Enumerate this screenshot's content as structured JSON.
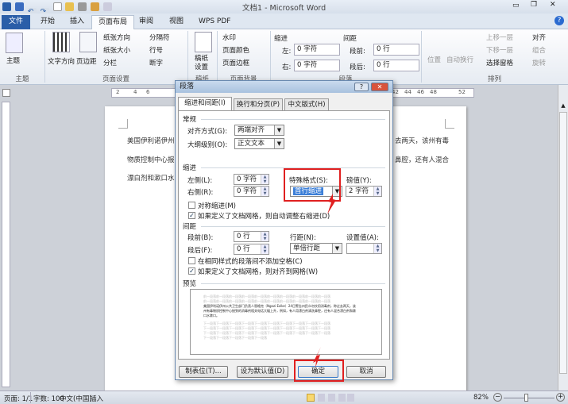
{
  "window": {
    "title": "文档1 - Microsoft Word"
  },
  "ribbon_tabs": [
    {
      "label": "文件"
    },
    {
      "label": "开始"
    },
    {
      "label": "插入"
    },
    {
      "label": "页面布局"
    },
    {
      "label": "审阅"
    },
    {
      "label": "视图"
    },
    {
      "label": "WPS PDF"
    }
  ],
  "ribbon": {
    "theme": {
      "label": "主题",
      "group": "主题"
    },
    "page_setup": {
      "text_direction": "文字方向",
      "margins": "页边距",
      "orientation": "纸张方向",
      "size": "纸张大小",
      "columns": "分栏",
      "breaks": "分隔符",
      "line_numbers": "行号",
      "hyphenation": "断字",
      "group": "页面设置"
    },
    "draft": {
      "label": "稿纸\n设置",
      "group": "稿纸"
    },
    "background": {
      "watermark": "水印",
      "page_color": "页面颜色",
      "page_borders": "页面边框",
      "group": "页面背景"
    },
    "paragraph": {
      "indent_label": "缩进",
      "left_label": "左:",
      "left_value": "0 字符",
      "right_label": "右:",
      "right_value": "0 字符",
      "spacing_label": "间距",
      "before_label": "段前:",
      "before_value": "0 行",
      "after_label": "段后:",
      "after_value": "0 行",
      "group": "段落"
    },
    "arrange": {
      "position": "位置",
      "wrap": "自动换行",
      "forward": "上移一层",
      "backward": "下移一层",
      "selection_pane": "选择窗格",
      "align": "对齐",
      "group_btn": "组合",
      "rotate": "旋转",
      "group": "排列"
    }
  },
  "ruler": {
    "ticks": [
      "2",
      "2",
      "4",
      "6",
      "42",
      "44",
      "46",
      "48",
      "52"
    ]
  },
  "document": {
    "lines": [
      "美国伊利诺伊州",
      "物质控制中心报",
      "漂白剂和漱口水",
      "去两天，该州有毒",
      "鼻腔，还有人混合"
    ]
  },
  "dialog": {
    "title": "段落",
    "help": "?",
    "close": "✕",
    "tabs": [
      {
        "label": "缩进和间距(I)"
      },
      {
        "label": "换行和分页(P)"
      },
      {
        "label": "中文版式(H)"
      }
    ],
    "general": {
      "title": "常规",
      "alignment_label": "对齐方式(G):",
      "alignment_value": "两端对齐",
      "outline_label": "大纲级别(O):",
      "outline_value": "正文文本"
    },
    "indent": {
      "title": "缩进",
      "left_label": "左侧(L):",
      "left_value": "0 字符",
      "right_label": "右侧(R):",
      "right_value": "0 字符",
      "special_label": "特殊格式(S):",
      "special_value": "首行缩进",
      "by_label": "磅值(Y):",
      "by_value": "2 字符",
      "mirror_label": "对称缩进(M)",
      "mirror_checked": false,
      "auto_adjust_label": "如果定义了文档网格，则自动调整右缩进(D)",
      "auto_adjust_checked": true
    },
    "spacing": {
      "title": "间距",
      "before_label": "段前(B):",
      "before_value": "0 行",
      "after_label": "段后(F):",
      "after_value": "0 行",
      "line_label": "行距(N):",
      "line_value": "单倍行距",
      "at_label": "设置值(A):",
      "at_value": "",
      "no_space_label": "在相同样式的段落间不添加空格(C)",
      "no_space_checked": false,
      "snap_label": "如果定义了文档网格，则对齐到网格(W)",
      "snap_checked": true
    },
    "preview": {
      "title": "预览",
      "prev_text": "前一段落前一段落前一段落前一段落前一段落前一段落前一段落前一段落前一段落前一段落",
      "sample_text": "美国伊利诺伊州公共卫生部门负责人恩格克（Ngozi Ezike）24日警告州民众勿饮用消毒剂，称过去两天，该州有毒物质控制中心接到的消毒剂相关电话大幅上升，例如，有人用漂白剂清洗鼻腔，还有人混合漂白剂和漱口水漱口。",
      "next_text": "下一段落下一段落下一段落下一段落下一段落下一段落下一段落下一段落下一段落下一段落"
    },
    "buttons": {
      "tabs": "制表位(T)...",
      "default": "设为默认值(D)",
      "ok": "确定",
      "cancel": "取消"
    }
  },
  "status": {
    "page": "页面: 1/1",
    "words": "字数: 100",
    "language": "中文(中国)",
    "mode": "插入",
    "zoom": "82%"
  },
  "colors": {
    "accent": "#2a5ea8",
    "highlight": "#e02020",
    "selection": "#3c7fd8"
  }
}
